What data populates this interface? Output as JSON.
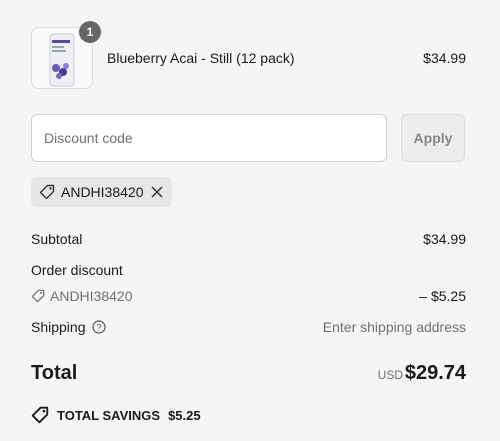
{
  "line_item": {
    "name": "Blueberry Acai - Still (12 pack)",
    "price": "$34.99",
    "quantity": "1",
    "image_icon": "product-can-image"
  },
  "discount": {
    "placeholder": "Discount code",
    "apply_label": "Apply",
    "applied_code": "ANDHI38420"
  },
  "summary": {
    "subtotal_label": "Subtotal",
    "subtotal_value": "$34.99",
    "order_discount_label": "Order discount",
    "order_discount_code": "ANDHI38420",
    "order_discount_value": "– $5.25",
    "shipping_label": "Shipping",
    "shipping_value": "Enter shipping address",
    "total_label": "Total",
    "currency": "USD",
    "total_value": "$29.74",
    "savings_label": "TOTAL SAVINGS",
    "savings_value": "$5.25"
  }
}
